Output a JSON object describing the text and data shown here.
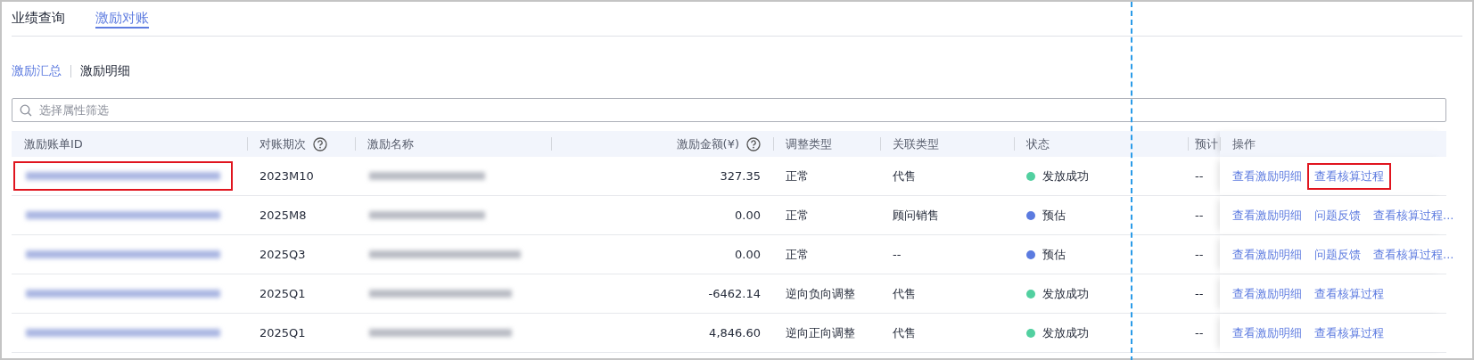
{
  "tabs": [
    {
      "label": "业绩查询",
      "selected": false
    },
    {
      "label": "激励对账",
      "selected": true
    }
  ],
  "subtabs": [
    {
      "label": "激励汇总",
      "selected": true
    },
    {
      "label": "激励明细",
      "selected": false
    }
  ],
  "search": {
    "placeholder": "选择属性筛选"
  },
  "table": {
    "columns": [
      {
        "label": "激励账单ID"
      },
      {
        "label": "对账期次",
        "help": true
      },
      {
        "label": "激励名称"
      },
      {
        "label": "激励金额(¥)",
        "help": true
      },
      {
        "label": "调整类型"
      },
      {
        "label": "关联类型"
      },
      {
        "label": "状态"
      },
      {
        "label": "预计"
      },
      {
        "label": "操作"
      }
    ],
    "rows": [
      {
        "id_redacted": true,
        "id_highlighted": true,
        "period": "2023M10",
        "name_redacted": true,
        "amount": "327.35",
        "adjust_type": "正常",
        "link_type": "代售",
        "status": {
          "label": "发放成功",
          "color": "#52d0a0"
        },
        "estimate": "--",
        "actions": [
          {
            "label": "查看激励明细",
            "highlighted": false
          },
          {
            "label": "查看核算过程",
            "highlighted": true
          }
        ]
      },
      {
        "id_redacted": true,
        "id_highlighted": false,
        "period": "2025M8",
        "name_redacted": true,
        "amount": "0.00",
        "adjust_type": "正常",
        "link_type": "顾问销售",
        "status": {
          "label": "预估",
          "color": "#5b7be0"
        },
        "estimate": "--",
        "actions": [
          {
            "label": "查看激励明细",
            "highlighted": false
          },
          {
            "label": "问题反馈",
            "highlighted": false
          },
          {
            "label": "查看核算过程...",
            "highlighted": false
          }
        ]
      },
      {
        "id_redacted": true,
        "id_highlighted": false,
        "period": "2025Q3",
        "name_redacted": true,
        "amount": "0.00",
        "adjust_type": "正常",
        "link_type": "--",
        "status": {
          "label": "预估",
          "color": "#5b7be0"
        },
        "estimate": "--",
        "actions": [
          {
            "label": "查看激励明细",
            "highlighted": false
          },
          {
            "label": "问题反馈",
            "highlighted": false
          },
          {
            "label": "查看核算过程...",
            "highlighted": false
          }
        ]
      },
      {
        "id_redacted": true,
        "id_highlighted": false,
        "period": "2025Q1",
        "name_redacted": true,
        "amount": "-6462.14",
        "adjust_type": "逆向负向调整",
        "link_type": "代售",
        "status": {
          "label": "发放成功",
          "color": "#52d0a0"
        },
        "estimate": "--",
        "actions": [
          {
            "label": "查看激励明细",
            "highlighted": false
          },
          {
            "label": "查看核算过程",
            "highlighted": false
          }
        ]
      },
      {
        "id_redacted": true,
        "id_highlighted": false,
        "period": "2025Q1",
        "name_redacted": true,
        "amount": "4,846.60",
        "adjust_type": "逆向正向调整",
        "link_type": "代售",
        "status": {
          "label": "发放成功",
          "color": "#52d0a0"
        },
        "estimate": "--",
        "actions": [
          {
            "label": "查看激励明细",
            "highlighted": false
          },
          {
            "label": "查看核算过程",
            "highlighted": false
          }
        ]
      }
    ]
  }
}
